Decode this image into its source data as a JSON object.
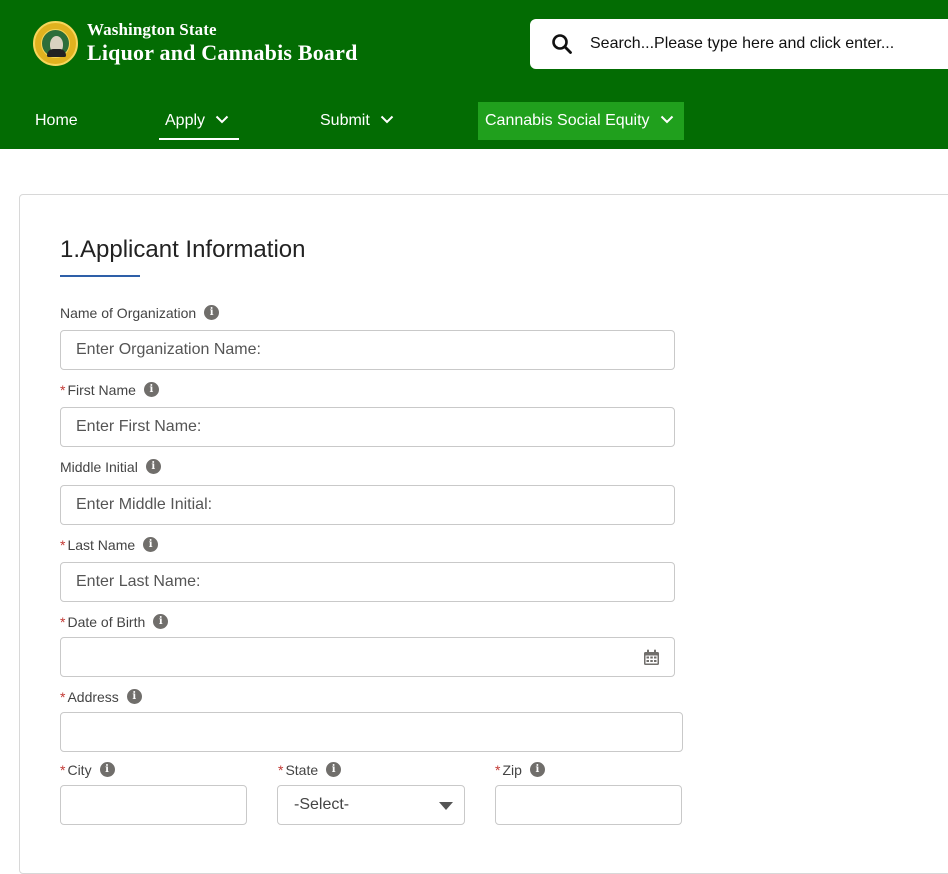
{
  "brand": {
    "line1": "Washington State",
    "line2": "Liquor and Cannabis Board",
    "seal_icon": "washington-state-seal-icon"
  },
  "search": {
    "placeholder": "Search...Please type here and click enter...",
    "icon": "search-icon"
  },
  "nav": {
    "home": "Home",
    "apply": "Apply",
    "submit": "Submit",
    "equity": "Cannabis Social Equity"
  },
  "form": {
    "section_title": "1.Applicant Information",
    "organization": {
      "label": "Name of Organization",
      "placeholder": "Enter Organization Name:"
    },
    "first_name": {
      "required": "*",
      "label": "First Name",
      "placeholder": "Enter First Name:"
    },
    "middle_initial": {
      "label": "Middle Initial",
      "placeholder": "Enter Middle Initial:"
    },
    "last_name": {
      "required": "*",
      "label": "Last Name",
      "placeholder": "Enter Last Name:"
    },
    "dob": {
      "required": "*",
      "label": "Date of Birth",
      "value": ""
    },
    "address": {
      "required": "*",
      "label": "Address",
      "value": ""
    },
    "city": {
      "required": "*",
      "label": "City",
      "value": ""
    },
    "state": {
      "required": "*",
      "label": "State",
      "selected": "-Select-"
    },
    "zip": {
      "required": "*",
      "label": "Zip",
      "value": ""
    }
  },
  "colors": {
    "header_green": "#036c03",
    "equity_highlight": "#20a01d",
    "underline_blue": "#2e5fa8",
    "required_red": "#c23934"
  }
}
